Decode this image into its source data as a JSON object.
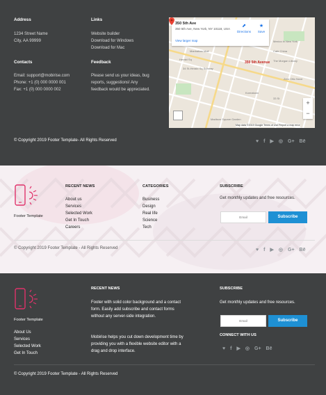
{
  "top": {
    "address": {
      "heading": "Address",
      "lines": [
        "1234 Street Name",
        "City, AA 99999"
      ]
    },
    "links": {
      "heading": "Links",
      "items": [
        "Website builder",
        "Download for Windows",
        "Download for Mac"
      ]
    },
    "contacts": {
      "heading": "Contacts",
      "lines": [
        "Email: support@mobirise.com",
        "Phone: +1 (0) 000 0000 001",
        "Fax: +1 (0) 000 0000 002"
      ]
    },
    "feedback": {
      "heading": "Feedback",
      "lines": [
        "Please send us your ideas, bug",
        "reports, suggestions! Any",
        "feedback would be appreciated."
      ]
    },
    "map": {
      "place_name": "350 5th Ave",
      "place_address": "350 5th Ave, New York, NY 10118, USA",
      "directions_label": "Directions",
      "save_label": "Save",
      "larger_map_label": "View larger map",
      "pin_label": "350 5th Avenue",
      "footer_text": "Map data ©2019 Google   Terms of Use   Report a map error",
      "zoom_in": "+",
      "zoom_out": "−"
    },
    "copyright": "© Copyright 2019 Footer Template- All Rights Reserved",
    "social_icons": [
      "twitter-icon",
      "facebook-icon",
      "youtube-icon",
      "instagram-icon",
      "google-plus-icon",
      "behance-icon"
    ]
  },
  "middle": {
    "brand": "Footer Template",
    "recent_news": {
      "heading": "RECENT NEWS",
      "items": [
        "About us",
        "Services",
        "Selected Work",
        "Get In Touch",
        "Careers"
      ]
    },
    "categories": {
      "heading": "CATEGORIES",
      "items": [
        "Business",
        "Design",
        "Real life",
        "Science",
        "Tech"
      ]
    },
    "subscribe": {
      "heading": "SUBSCRIBE",
      "blurb": "Get monthly updates and free resources.",
      "email_placeholder": "Email",
      "button_label": "Subscribe"
    },
    "copyright": "© Copyright 2019 Footer Template - All Rights Reserved",
    "social_icons": [
      "twitter-icon",
      "facebook-icon",
      "youtube-icon",
      "instagram-icon",
      "google-plus-icon",
      "behance-icon"
    ]
  },
  "bottom": {
    "brand": "Footer Template",
    "nav": [
      "About Us",
      "Services",
      "Selected Work",
      "Get In Touch"
    ],
    "recent_news": {
      "heading": "RECENT NEWS",
      "para1": "Footer with solid color background and a contact form. Easily add subscribe and contact forms without any server-side integration.",
      "para2": "Mobirise helps you cut down development time by providing you with a flexible website editor with a drag and drop interface."
    },
    "subscribe": {
      "heading": "SUBSCRIBE",
      "blurb": "Get monthly updates and free resources.",
      "email_placeholder": "Email",
      "button_label": "Subscribe"
    },
    "connect": {
      "heading": "CONNECT WITH US"
    },
    "copyright": "© Copyright 2019 Footer Template - All Rights Reserved",
    "social_icons": [
      "twitter-icon",
      "facebook-icon",
      "youtube-icon",
      "instagram-icon",
      "google-plus-icon",
      "behance-icon"
    ]
  },
  "colors": {
    "dark_bg": "#3f4142",
    "light_bg": "#f5eff2",
    "accent_blue": "#1e90d4",
    "logo_pink": "#e0336b"
  }
}
